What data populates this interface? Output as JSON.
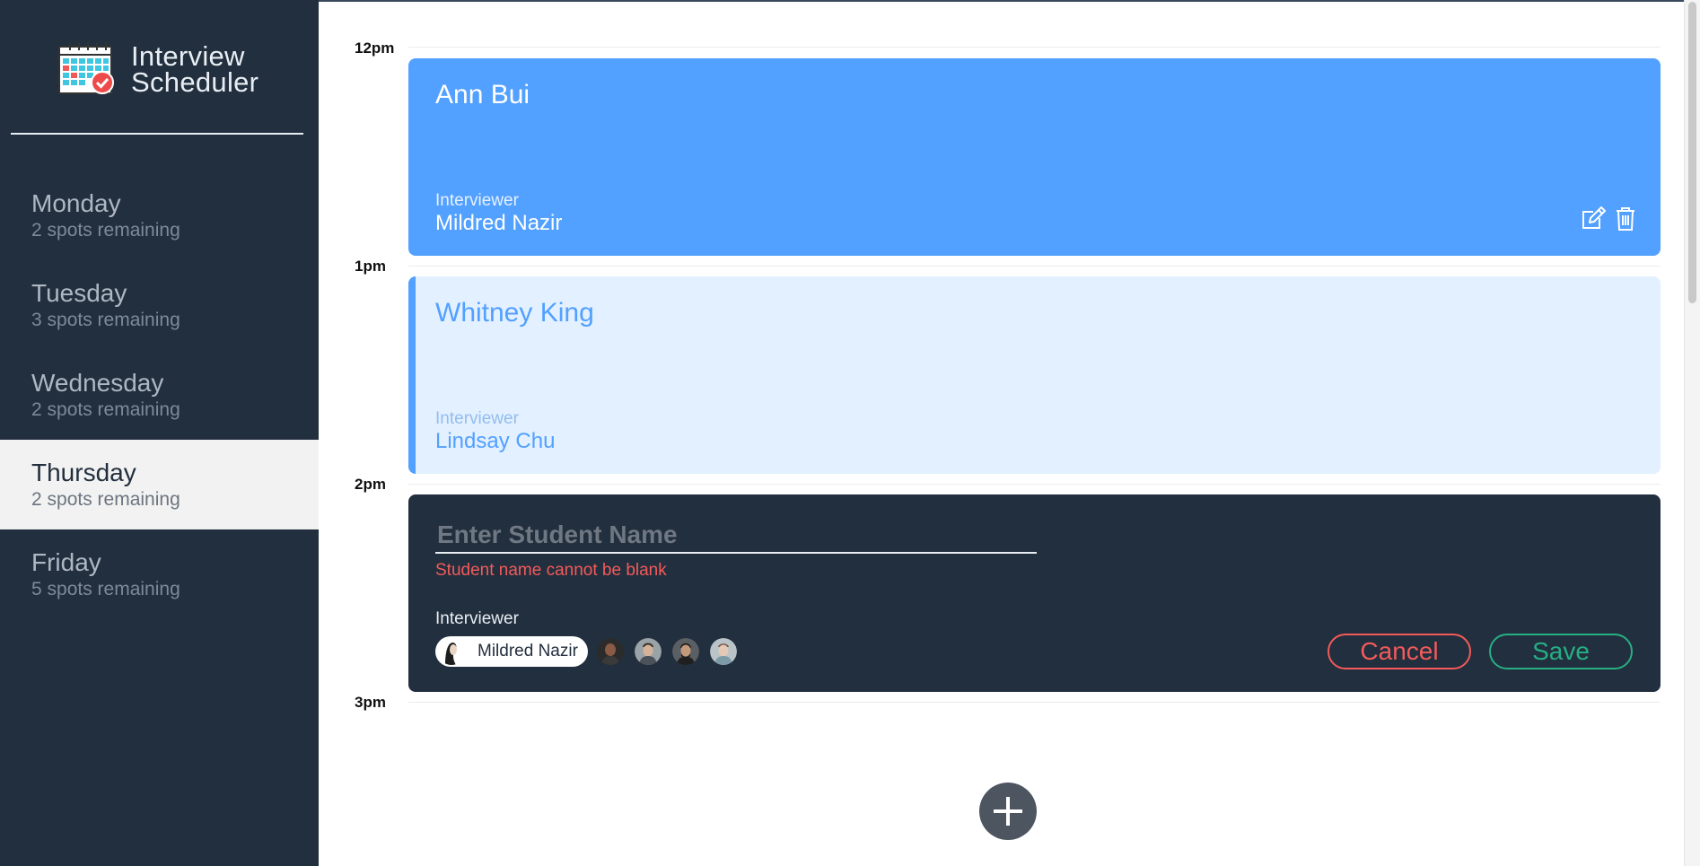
{
  "sidebar": {
    "brand": {
      "line1": "Interview",
      "line2": "Scheduler",
      "icon": "calendar-check-icon"
    },
    "days": [
      {
        "name": "Monday",
        "spots": "2 spots remaining",
        "selected": false
      },
      {
        "name": "Tuesday",
        "spots": "3 spots remaining",
        "selected": false
      },
      {
        "name": "Wednesday",
        "spots": "2 spots remaining",
        "selected": false
      },
      {
        "name": "Thursday",
        "spots": "2 spots remaining",
        "selected": true
      },
      {
        "name": "Friday",
        "spots": "5 spots remaining",
        "selected": false
      }
    ]
  },
  "schedule": {
    "times": [
      "12pm",
      "1pm",
      "2pm",
      "3pm"
    ],
    "appointments": [
      {
        "student": "Ann Bui",
        "interviewer_label": "Interviewer",
        "interviewer": "Mildred Nazir",
        "icons": [
          "edit-icon",
          "trash-icon"
        ]
      },
      {
        "student": "Whitney King",
        "interviewer_label": "Interviewer",
        "interviewer": "Lindsay Chu"
      }
    ],
    "form": {
      "placeholder": "Enter Student Name",
      "value": "",
      "error": "Student name cannot be blank",
      "interviewer_label": "Interviewer",
      "selected_interviewer": "Mildred Nazir",
      "cancel_label": "Cancel",
      "save_label": "Save"
    },
    "add_icon": "plus-icon"
  },
  "colors": {
    "sidebar_bg": "#222f3e",
    "booked": "#52a0ff",
    "booked_light": "#e3f0ff",
    "error": "#f45a5a",
    "save": "#27ae84",
    "selected_day_bg": "#f2f2f2"
  }
}
